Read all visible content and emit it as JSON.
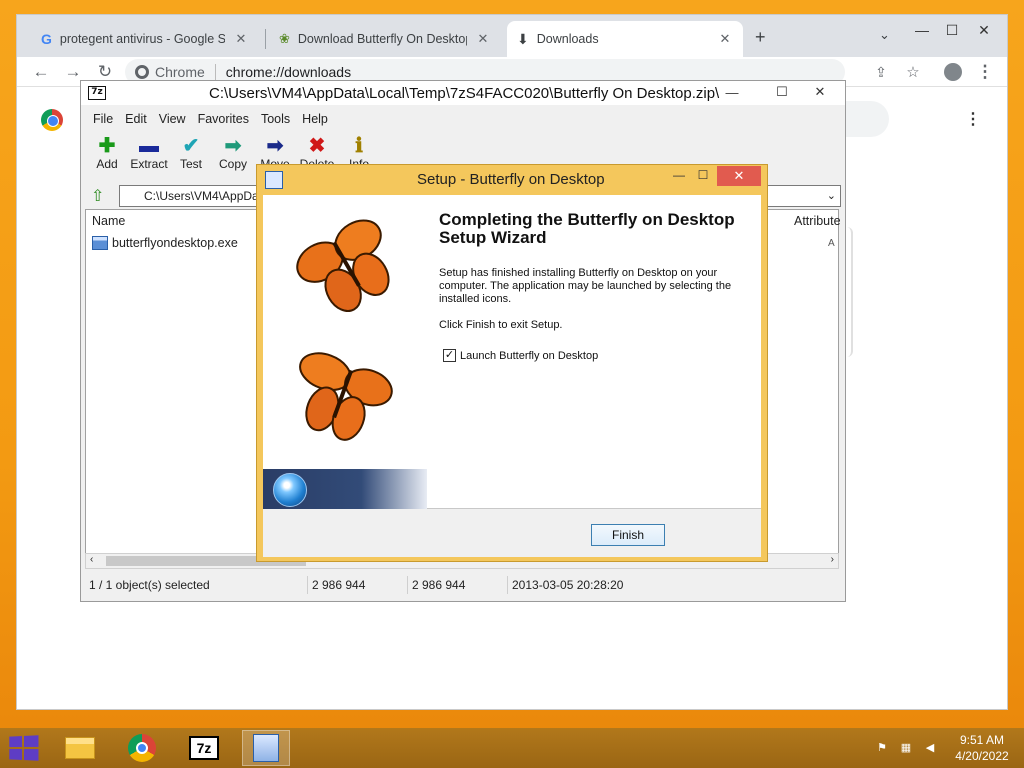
{
  "browser": {
    "tabs": [
      {
        "title": "protegent antivirus - Google Sea",
        "icon": "google-g-icon"
      },
      {
        "title": "Download Butterfly On Desktop",
        "icon": "butterfly-site-icon"
      },
      {
        "title": "Downloads",
        "icon": "download-icon"
      }
    ],
    "omnibox_chip": "Chrome",
    "url": "chrome://downloads",
    "window_controls": {
      "minimize": "—",
      "maximize": "☐",
      "close": "✕"
    }
  },
  "zip": {
    "title": "C:\\Users\\VM4\\AppData\\Local\\Temp\\7zS4FACC020\\Butterfly On Desktop.zip\\",
    "logo": "7z",
    "menu": [
      "File",
      "Edit",
      "View",
      "Favorites",
      "Tools",
      "Help"
    ],
    "tools": [
      {
        "label": "Add",
        "icon": "✚",
        "color": "#1a9a1a"
      },
      {
        "label": "Extract",
        "icon": "▬",
        "color": "#1a2a9a"
      },
      {
        "label": "Test",
        "icon": "✔",
        "color": "#1fa5b5"
      },
      {
        "label": "Copy",
        "icon": "➡",
        "color": "#1f9a7a"
      },
      {
        "label": "Move",
        "icon": "➡",
        "color": "#1a2a8a"
      },
      {
        "label": "Delete",
        "icon": "✖",
        "color": "#d01818"
      },
      {
        "label": "Info",
        "icon": "ℹ",
        "color": "#a08000"
      }
    ],
    "address": "C:\\Users\\VM4\\AppData\\Local\\Temp\\7zS4FACC020\\Butterfly On Desktop.zip\\",
    "columns": {
      "name": "Name",
      "attributes": "Attribute"
    },
    "files": [
      {
        "name": "butterflyondesktop.exe",
        "attr_marker": "A"
      }
    ],
    "status": {
      "selected": "1 / 1 object(s) selected",
      "size": "2 986 944",
      "packed": "2 986 944",
      "modified": "2013-03-05 20:28:20"
    }
  },
  "setup": {
    "title": "Setup - Butterfly on Desktop",
    "heading": "Completing the Butterfly on Desktop Setup Wizard",
    "finished_text": "Setup has finished installing Butterfly on Desktop on your computer. The application may be launched by selecting the installed icons.",
    "click_finish_text": "Click Finish to exit Setup.",
    "launch_label": "Launch Butterfly on Desktop",
    "launch_checked": true,
    "finish_label": "Finish"
  },
  "taskbar": {
    "apps": [
      {
        "name": "file-explorer",
        "icon": "folder-icon"
      },
      {
        "name": "chrome",
        "icon": "chrome-icon"
      },
      {
        "name": "7zip",
        "icon": "7z",
        "active": false
      },
      {
        "name": "setup",
        "icon": "setup-icon",
        "active": true
      }
    ],
    "time": "9:51 AM",
    "date": "4/20/2022"
  },
  "colors": {
    "desktop": "#f39a12",
    "taskbar": "#a86d17",
    "setup_frame": "#f4c75c",
    "close_red": "#e15b4f",
    "start_purple": "#5e3dc4"
  }
}
